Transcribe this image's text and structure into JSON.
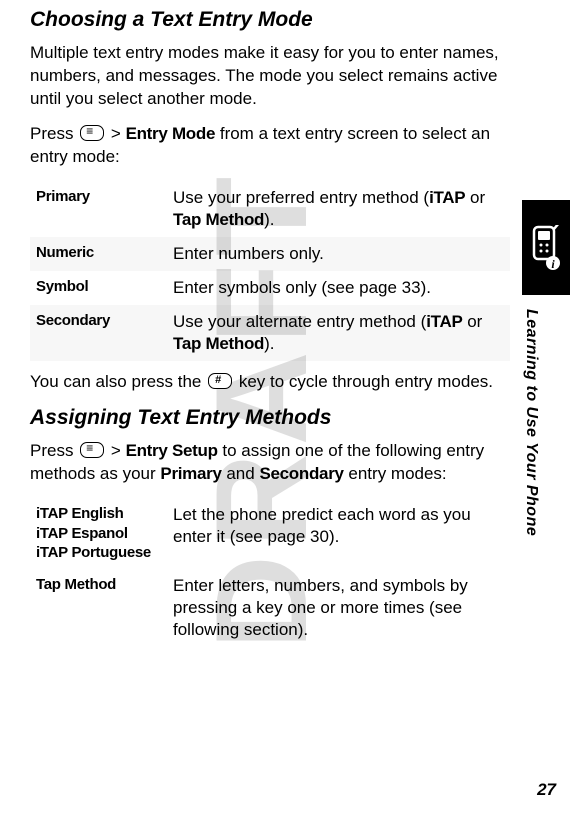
{
  "watermark": "DRAFT",
  "section1": {
    "title": "Choosing a Text Entry Mode",
    "para1": "Multiple text entry modes make it easy for you to enter names, numbers, and messages. The mode you select remains active until you select another mode.",
    "para2_pre": "Press ",
    "para2_mid": " > ",
    "para2_bold": "Entry Mode",
    "para2_post": " from a text entry screen to select an entry mode:",
    "table": [
      {
        "term": "Primary",
        "desc_pre": "Use your preferred entry method (",
        "b1": "iTAP",
        "mid": " or ",
        "b2": "Tap Method",
        "post": ")."
      },
      {
        "term": "Numeric",
        "desc": "Enter numbers only."
      },
      {
        "term": "Symbol",
        "desc": "Enter symbols only (see page 33)."
      },
      {
        "term": "Secondary",
        "desc_pre": "Use your alternate entry method (",
        "b1": "iTAP",
        "mid": " or ",
        "b2": "Tap Method",
        "post": ")."
      }
    ],
    "para3_pre": "You can also press the ",
    "para3_post": " key to cycle through entry modes."
  },
  "section2": {
    "title": "Assigning Text Entry Methods",
    "para1_pre": "Press ",
    "para1_mid": " > ",
    "para1_b1": "Entry Setup",
    "para1_mid2": " to assign one of the following entry methods as your ",
    "para1_b2": "Primary",
    "para1_mid3": " and ",
    "para1_b3": "Secondary",
    "para1_post": " entry modes:",
    "table": [
      {
        "term1": "iTAP English",
        "term2": "iTAP Espanol",
        "term3": "iTAP Portuguese",
        "desc": "Let the phone predict each word as you enter it (see page 30)."
      },
      {
        "term1": "Tap Method",
        "desc": "Enter letters, numbers, and symbols by pressing a key one or more times (see following section)."
      }
    ]
  },
  "sidebar": {
    "label": "Learning to Use Your Phone"
  },
  "page_number": "27"
}
